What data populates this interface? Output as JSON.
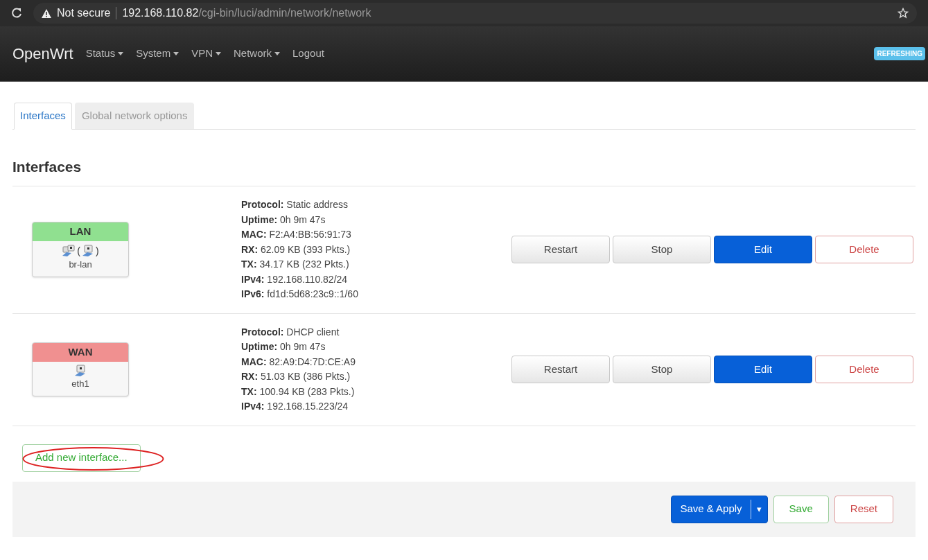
{
  "browser": {
    "security": "Not secure",
    "url_host": "192.168.110.82",
    "url_path": "/cgi-bin/luci/admin/network/network"
  },
  "navbar": {
    "brand": "OpenWrt",
    "items": [
      {
        "label": "Status",
        "dropdown": true
      },
      {
        "label": "System",
        "dropdown": true
      },
      {
        "label": "VPN",
        "dropdown": true
      },
      {
        "label": "Network",
        "dropdown": true
      },
      {
        "label": "Logout",
        "dropdown": false
      }
    ],
    "badge": "REFRESHING"
  },
  "tabs": [
    {
      "label": "Interfaces",
      "selected": true
    },
    {
      "label": "Global network options",
      "selected": false
    }
  ],
  "heading": "Interfaces",
  "interfaces": [
    {
      "name": "LAN",
      "color": "#90e090",
      "kind": "bridge",
      "brackets": [
        "(",
        ")"
      ],
      "device": "br-lan",
      "details": [
        {
          "label": "Protocol:",
          "value": "Static address"
        },
        {
          "label": "Uptime:",
          "value": "0h 9m 47s"
        },
        {
          "label": "MAC:",
          "value": "F2:A4:BB:56:91:73"
        },
        {
          "label": "RX:",
          "value": "62.09 KB (393 Pkts.)"
        },
        {
          "label": "TX:",
          "value": "34.17 KB (232 Pkts.)"
        },
        {
          "label": "IPv4:",
          "value": "192.168.110.82/24"
        },
        {
          "label": "IPv6:",
          "value": "fd1d:5d68:23c9::1/60"
        }
      ],
      "buttons": [
        {
          "label": "Restart",
          "kind": "neutral"
        },
        {
          "label": "Stop",
          "kind": "neutral"
        },
        {
          "label": "Edit",
          "kind": "primary"
        },
        {
          "label": "Delete",
          "kind": "danger"
        }
      ]
    },
    {
      "name": "WAN",
      "color": "#f09090",
      "kind": "ethernet",
      "device": "eth1",
      "details": [
        {
          "label": "Protocol:",
          "value": "DHCP client"
        },
        {
          "label": "Uptime:",
          "value": "0h 9m 47s"
        },
        {
          "label": "MAC:",
          "value": "82:A9:D4:7D:CE:A9"
        },
        {
          "label": "RX:",
          "value": "51.03 KB (386 Pkts.)"
        },
        {
          "label": "TX:",
          "value": "100.94 KB (283 Pkts.)"
        },
        {
          "label": "IPv4:",
          "value": "192.168.15.223/24"
        }
      ],
      "buttons": [
        {
          "label": "Restart",
          "kind": "neutral"
        },
        {
          "label": "Stop",
          "kind": "neutral"
        },
        {
          "label": "Edit",
          "kind": "primary"
        },
        {
          "label": "Delete",
          "kind": "danger"
        }
      ]
    }
  ],
  "add_button": {
    "label": "Add new interface...",
    "highlighted": true
  },
  "footer": {
    "buttons": [
      {
        "label": "Save & Apply",
        "kind": "primary",
        "dropdown": "▾"
      },
      {
        "label": "Save",
        "kind": "positive"
      },
      {
        "label": "Reset",
        "kind": "danger"
      }
    ]
  }
}
